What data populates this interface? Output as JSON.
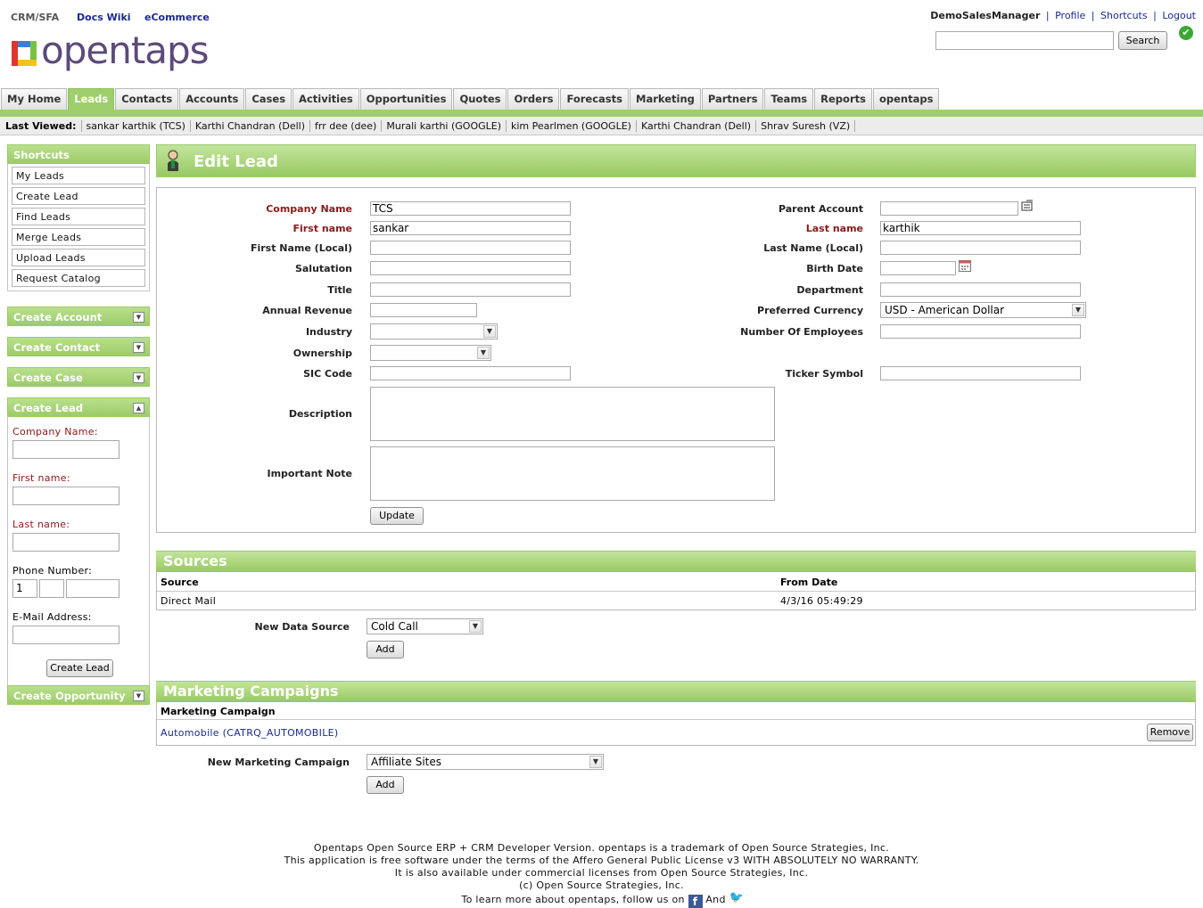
{
  "top": {
    "apps": [
      "CRM/SFA",
      "Docs Wiki",
      "eCommerce"
    ],
    "logo_text": "opentaps",
    "user": "DemoSalesManager",
    "links": [
      "Profile",
      "Shortcuts",
      "Logout"
    ],
    "search_label": "Search"
  },
  "tabs": [
    "My Home",
    "Leads",
    "Contacts",
    "Accounts",
    "Cases",
    "Activities",
    "Opportunities",
    "Quotes",
    "Orders",
    "Forecasts",
    "Marketing",
    "Partners",
    "Teams",
    "Reports",
    "opentaps"
  ],
  "active_tab": "Leads",
  "last_viewed": {
    "label": "Last Viewed:",
    "items": [
      "sankar karthik (TCS)",
      "Karthi Chandran (Dell)",
      "frr dee (dee)",
      "Murali karthi (GOOGLE)",
      "kim Pearlmen (GOOGLE)",
      "Karthi Chandran (Dell)",
      "Shrav Suresh (VZ)"
    ]
  },
  "sidebar": {
    "shortcuts_title": "Shortcuts",
    "shortcuts": [
      "My Leads",
      "Create Lead",
      "Find Leads",
      "Merge Leads",
      "Upload Leads",
      "Request Catalog"
    ],
    "create_account": "Create Account",
    "create_contact": "Create Contact",
    "create_case": "Create Case",
    "create_lead": "Create Lead",
    "create_opportunity": "Create Opportunity",
    "quick_lead": {
      "company_label": "Company Name:",
      "first_label": "First name:",
      "last_label": "Last name:",
      "phone_label": "Phone Number:",
      "phone_country": "1",
      "email_label": "E-Mail Address:",
      "button": "Create Lead"
    }
  },
  "edit_lead": {
    "title": "Edit Lead",
    "labels": {
      "company_name": "Company Name",
      "first_name": "First name",
      "first_name_local": "First Name (Local)",
      "salutation": "Salutation",
      "title": "Title",
      "annual_revenue": "Annual Revenue",
      "industry": "Industry",
      "ownership": "Ownership",
      "sic_code": "SIC Code",
      "description": "Description",
      "important_note": "Important Note",
      "parent_account": "Parent Account",
      "last_name": "Last name",
      "last_name_local": "Last Name (Local)",
      "birth_date": "Birth Date",
      "department": "Department",
      "preferred_currency": "Preferred Currency",
      "number_of_employees": "Number Of Employees",
      "ticker_symbol": "Ticker Symbol"
    },
    "values": {
      "company_name": "TCS",
      "first_name": "sankar",
      "last_name": "karthik",
      "preferred_currency": "USD - American Dollar"
    },
    "update_button": "Update"
  },
  "sources": {
    "title": "Sources",
    "col_source": "Source",
    "col_from_date": "From Date",
    "row_source": "Direct Mail",
    "row_date": "4/3/16 05:49:29",
    "new_label": "New Data Source",
    "new_value": "Cold Call",
    "add_button": "Add"
  },
  "campaigns": {
    "title": "Marketing Campaigns",
    "col": "Marketing Campaign",
    "row": "Automobile (CATRQ_AUTOMOBILE)",
    "remove_button": "Remove",
    "new_label": "New Marketing Campaign",
    "new_value": "Affiliate Sites",
    "add_button": "Add"
  },
  "footer": {
    "line1": "Opentaps Open Source ERP + CRM Developer Version. opentaps is a trademark of Open Source Strategies, Inc.",
    "line2": "This application is free software under the terms of the Affero General Public License v3 WITH ABSOLUTELY NO WARRANTY.",
    "line3": "It is also available under commercial licenses from Open Source Strategies, Inc.",
    "line4": "(c) Open Source Strategies, Inc.",
    "line5_a": "To learn more about opentaps, follow us on",
    "line5_b": "And"
  },
  "colors": {
    "accent_green": "#9fcf6c",
    "link_blue": "#1a2a8f",
    "required_red": "#8b1a1a"
  },
  "icons": [
    "checkmark-icon",
    "person-icon",
    "lookup-icon",
    "calendar-icon",
    "chevron-down-icon",
    "chevron-up-icon",
    "facebook-icon",
    "twitter-icon"
  ]
}
